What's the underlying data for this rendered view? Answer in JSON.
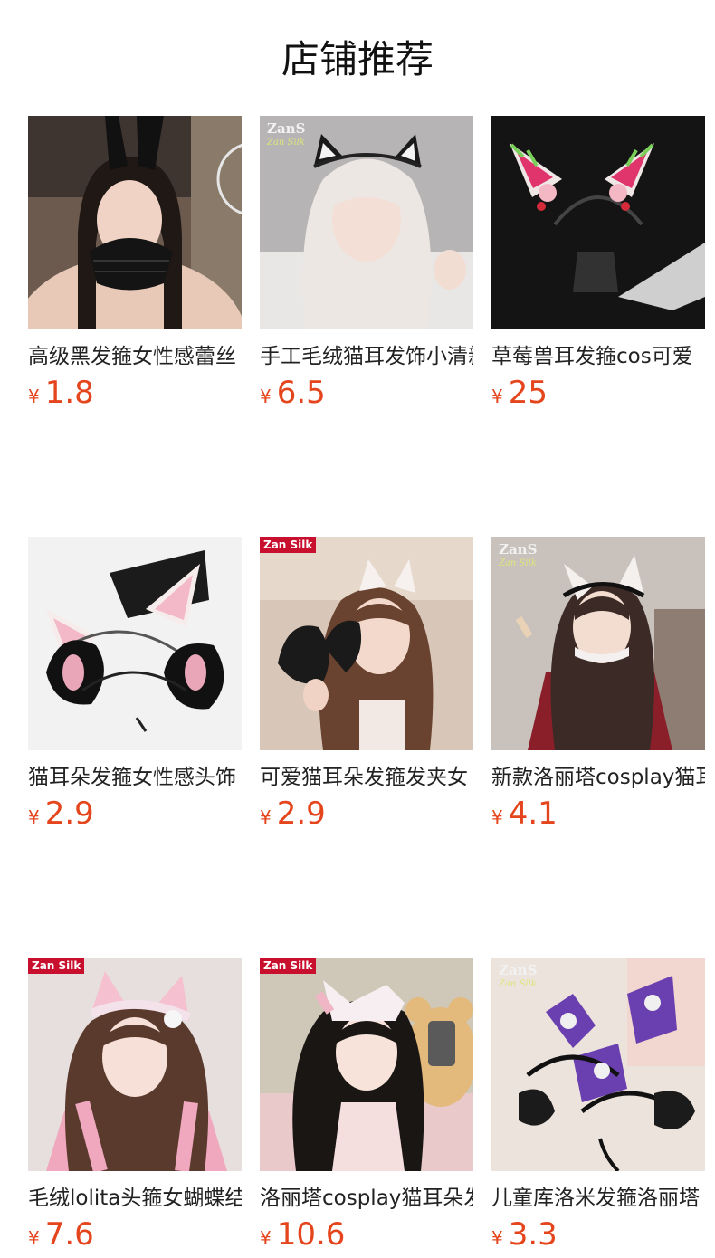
{
  "section": {
    "title": "店铺推荐"
  },
  "currency_symbol": "¥",
  "colors": {
    "price": "#e4451c",
    "badge": "#c8102e"
  },
  "products": [
    {
      "name": "高级黑发箍女性感蕾丝",
      "price": "1.8",
      "image": "bunny-ears-lace-mask-photo",
      "badge": ""
    },
    {
      "name": "手工毛绒猫耳发饰小清新",
      "price": "6.5",
      "image": "cat-ears-white-hair-photo",
      "watermark": "ZanS",
      "watermark_sub": "Zan Silk",
      "badge": ""
    },
    {
      "name": "草莓兽耳发箍cos可爱",
      "price": "25",
      "image": "strawberry-beast-ears-on-stand-photo",
      "badge": ""
    },
    {
      "name": "猫耳朵发箍女性感头饰",
      "price": "2.9",
      "image": "black-white-cat-ear-headbands-photo",
      "badge": ""
    },
    {
      "name": "可爱猫耳朵发箍发夹女",
      "price": "2.9",
      "image": "girl-holding-cat-ears-photo",
      "badge": "Zan Silk"
    },
    {
      "name": "新款洛丽塔cosplay猫耳",
      "price": "4.1",
      "image": "lolita-maid-cat-ears-photo",
      "watermark": "ZanS",
      "watermark_sub": "Zan Silk",
      "badge": ""
    },
    {
      "name": "毛绒lolita头箍女蝴蝶结",
      "price": "7.6",
      "image": "pink-fluffy-ears-girl-photo",
      "badge": "Zan Silk"
    },
    {
      "name": "洛丽塔cosplay猫耳朵发",
      "price": "10.6",
      "image": "lolita-bear-phone-girl-photo",
      "badge": "Zan Silk"
    },
    {
      "name": "儿童库洛米发箍洛丽塔",
      "price": "3.3",
      "image": "kuromi-purple-headbands-photo",
      "watermark": "ZanS",
      "watermark_sub": "Zan Silk",
      "badge": ""
    }
  ]
}
